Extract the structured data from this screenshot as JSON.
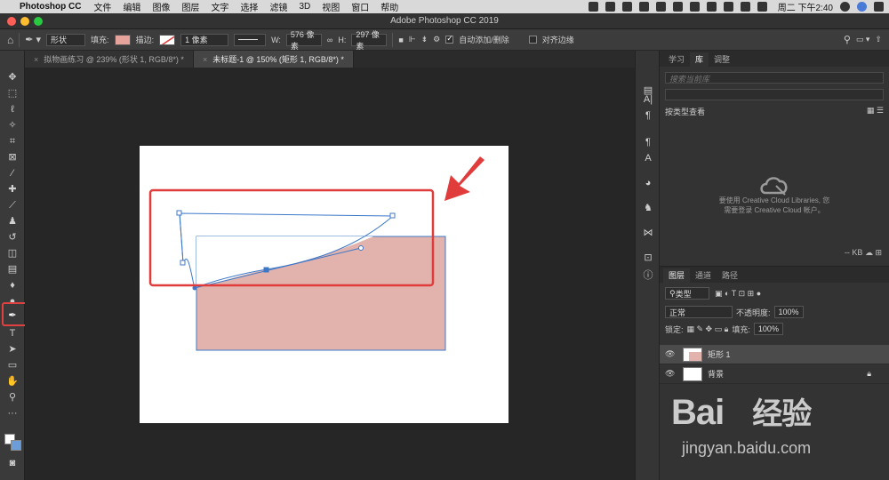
{
  "menubar": {
    "app_name": "Photoshop CC",
    "menus": [
      "文件",
      "编辑",
      "图像",
      "图层",
      "文字",
      "选择",
      "滤镜",
      "3D",
      "视图",
      "窗口",
      "帮助"
    ],
    "clock": "周二 下午2:40"
  },
  "window": {
    "title": "Adobe Photoshop CC 2019"
  },
  "options": {
    "mode": "形状",
    "fill_label": "填充:",
    "fill_color": "#e5a39c",
    "stroke_label": "描边:",
    "stroke_width": "1 像素",
    "w_label": "W:",
    "w_value": "576 像素",
    "h_label": "H:",
    "h_value": "297 像素",
    "auto_add_label": "自动添加/删除",
    "align_edges_label": "对齐边缘"
  },
  "tabs": [
    {
      "label": "拟物画练习 @ 239% (形状 1, RGB/8*) *",
      "active": false
    },
    {
      "label": "未标题-1 @ 150% (矩形 1, RGB/8*) *",
      "active": true
    }
  ],
  "panel": {
    "tabs": [
      "学习",
      "库",
      "调整"
    ],
    "search_placeholder": "搜索当前库",
    "view_by": "按类型查看",
    "cc_message_line1": "要使用 Creative Cloud Libraries, 您",
    "cc_message_line2": "需要登录 Creative Cloud 帐户。",
    "size_label": "-- KB"
  },
  "layers": {
    "tabs": [
      "图层",
      "通道",
      "路径"
    ],
    "filter_label": "类型",
    "blend_mode": "正常",
    "opacity_label": "不透明度:",
    "opacity_value": "100%",
    "lock_label": "锁定:",
    "fill_label": "填充:",
    "fill_value": "100%",
    "items": [
      {
        "name": "矩形 1",
        "selected": true
      },
      {
        "name": "背景",
        "selected": false
      }
    ]
  },
  "canvas": {
    "rect_fill": "#e2b3ad",
    "path_color": "#3d78c8",
    "annotation_color": "#e03c3c"
  },
  "watermark": {
    "brand": "Bai",
    "brand2": "经验",
    "url": "jingyan.baidu.com"
  }
}
